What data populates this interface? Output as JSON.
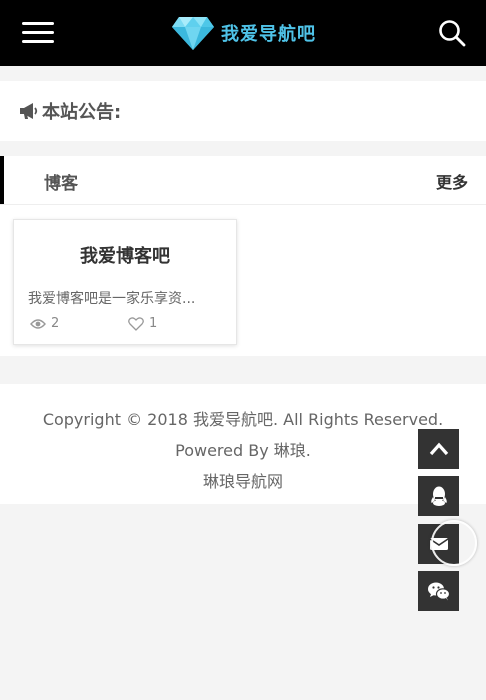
{
  "header": {
    "brand_text": "我爱导航吧",
    "brand_color": "#4fc3e8",
    "menu_icon": "hamburger-icon",
    "search_icon": "search-icon",
    "logo_icon": "diamond-icon"
  },
  "notice": {
    "label": "本站公告:",
    "icon": "megaphone-icon"
  },
  "section": {
    "title": "博客",
    "more_label": "更多",
    "cards": [
      {
        "title": "我爱博客吧",
        "description": "我爱博客吧是一家乐享资...",
        "views": "2",
        "likes": "1"
      }
    ]
  },
  "footer": {
    "copyright": "Copyright © 2018 我爱导航吧. All Rights Reserved.",
    "powered": "Powered By 琳琅.",
    "site_link": "琳琅导航网"
  },
  "floating": {
    "items": [
      "back-to-top-icon",
      "qq-icon",
      "mail-icon",
      "wechat-icon"
    ]
  }
}
